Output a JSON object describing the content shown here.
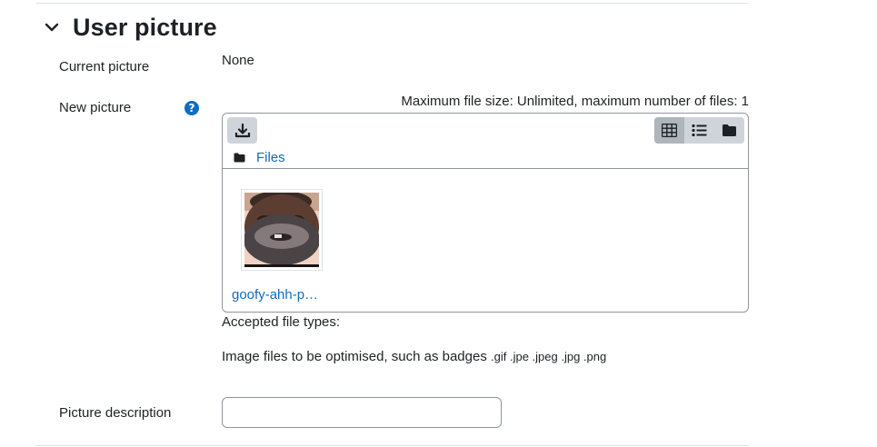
{
  "section": {
    "title": "User picture",
    "expand_icon": "chevron-down-icon"
  },
  "current_picture": {
    "label": "Current picture",
    "value": "None"
  },
  "new_picture": {
    "label": "New picture",
    "help_icon": "question-circle-icon",
    "help_glyph": "?",
    "max_info": "Maximum file size: Unlimited, maximum number of files: 1"
  },
  "filepicker": {
    "toolbar": {
      "download_icon": "download-icon",
      "views": [
        "grid-view-icon",
        "list-view-icon",
        "folder-view-icon"
      ],
      "active_view": "grid-view-icon"
    },
    "path": {
      "folder_icon": "folder-icon",
      "label": "Files"
    },
    "files": [
      {
        "name": "goofy-ahh-p…",
        "thumbnail": "bearded-face-photo"
      }
    ]
  },
  "accepted": {
    "title": "Accepted file types:",
    "description": "Image files to be optimised, such as badges",
    "extensions": ".gif .jpe .jpeg .jpg .png"
  },
  "picture_description": {
    "label": "Picture description",
    "value": "",
    "placeholder": ""
  },
  "colors": {
    "link": "#0f6cbf",
    "text": "#1d2125",
    "border": "#8f959e",
    "button_bg": "#ced4da",
    "button_active": "#adb5bd"
  }
}
